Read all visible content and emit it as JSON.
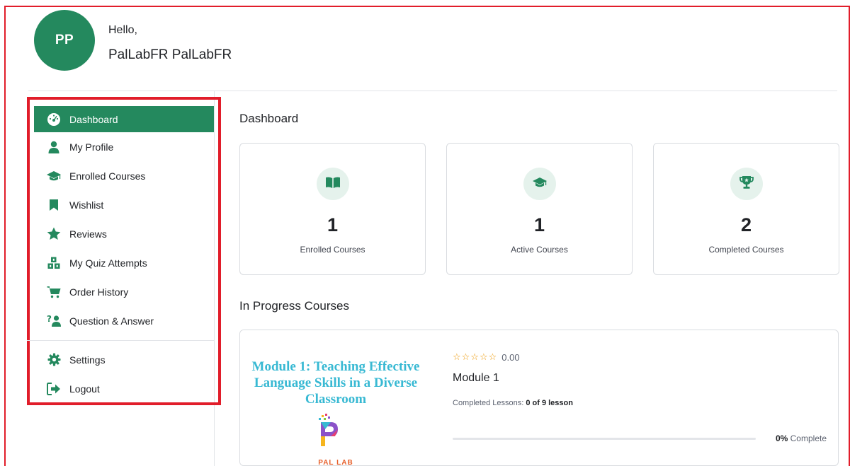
{
  "header": {
    "avatar_initials": "PP",
    "greeting": "Hello,",
    "user_name": "PalLabFR PalLabFR"
  },
  "sidebar": {
    "items": [
      {
        "label": "Dashboard",
        "icon": "dashboard-gauge-icon",
        "active": true
      },
      {
        "label": "My Profile",
        "icon": "user-icon",
        "active": false
      },
      {
        "label": "Enrolled Courses",
        "icon": "graduation-cap-icon",
        "active": false
      },
      {
        "label": "Wishlist",
        "icon": "bookmark-icon",
        "active": false
      },
      {
        "label": "Reviews",
        "icon": "star-icon",
        "active": false
      },
      {
        "label": "My Quiz Attempts",
        "icon": "quiz-blocks-icon",
        "active": false
      },
      {
        "label": "Order History",
        "icon": "cart-icon",
        "active": false
      },
      {
        "label": "Question & Answer",
        "icon": "question-answer-icon",
        "active": false
      }
    ],
    "footer_items": [
      {
        "label": "Settings",
        "icon": "gear-icon"
      },
      {
        "label": "Logout",
        "icon": "logout-icon"
      }
    ]
  },
  "main": {
    "title": "Dashboard",
    "stats": [
      {
        "value": "1",
        "label": "Enrolled Courses",
        "icon": "book-open-icon"
      },
      {
        "value": "1",
        "label": "Active Courses",
        "icon": "graduation-cap-icon"
      },
      {
        "value": "2",
        "label": "Completed Courses",
        "icon": "trophy-icon"
      }
    ],
    "in_progress_title": "In Progress Courses",
    "course": {
      "thumb_title": "Module 1: Teaching Effective Language Skills in a Diverse Classroom",
      "thumb_brand": "PAL LAB",
      "stars": "☆☆☆☆☆",
      "rating": "0.00",
      "name": "Module 1",
      "lessons_label": "Completed Lessons:",
      "lessons_value": "0 of 9 lesson",
      "progress_percent_text": "0%",
      "progress_suffix": "Complete",
      "progress_fraction": 0
    }
  },
  "colors": {
    "brand_green": "#24895e",
    "highlight_red": "#e11d2a",
    "star_orange": "#ed9700",
    "thumb_title_blue": "#38b9d3"
  }
}
